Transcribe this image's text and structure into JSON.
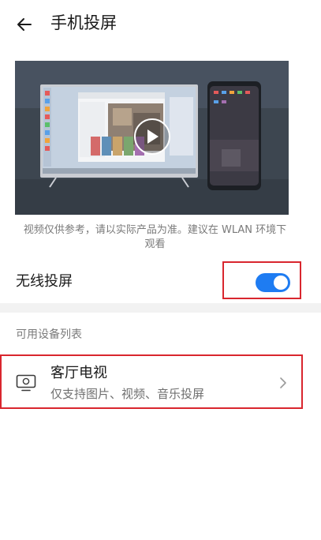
{
  "header": {
    "title": "手机投屏",
    "back_icon": "arrow-left-icon"
  },
  "demo_video": {
    "play_icon": "play-icon"
  },
  "caption": "视频仅供参考，请以实际产品为准。建议在 WLAN 环境下观看",
  "wireless": {
    "label": "无线投屏",
    "enabled": true,
    "toggle_color": "#1e7cf2"
  },
  "available_devices": {
    "section_label": "可用设备列表",
    "items": [
      {
        "name": "客厅电视",
        "subtitle": "仅支持图片、视频、音乐投屏",
        "icon": "tv-icon"
      }
    ]
  },
  "highlight_color": "#d9262e"
}
